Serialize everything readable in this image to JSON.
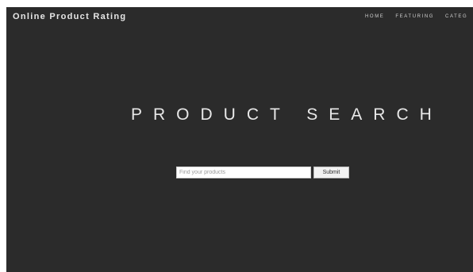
{
  "header": {
    "brand": "Online Product Rating",
    "nav": [
      "HOME",
      "FEATURING",
      "CATEG"
    ]
  },
  "hero": {
    "title": "PRODUCT SEARCH"
  },
  "search": {
    "placeholder": "Find your products",
    "value": "",
    "submit_label": "Submit"
  },
  "colors": {
    "background": "#2b2b2b",
    "text": "#e8e8e8"
  }
}
